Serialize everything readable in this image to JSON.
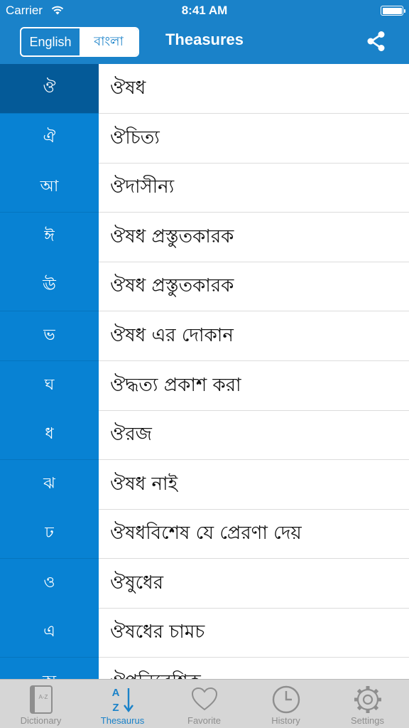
{
  "status_bar": {
    "carrier": "Carrier",
    "time": "8:41 AM"
  },
  "nav": {
    "segments": [
      {
        "label": "English",
        "selected": false
      },
      {
        "label": "বাংলা",
        "selected": true
      }
    ],
    "title": "Theasures"
  },
  "colors": {
    "accent": "#1a82c9",
    "letter_column": "#0882d3",
    "letter_selected": "#045a98"
  },
  "rows": [
    {
      "letter": "ঔ",
      "word": "ঔষধ"
    },
    {
      "letter": "ঐ",
      "word": "ঔচিত্য"
    },
    {
      "letter": "আ",
      "word": "ঔদাসীন্য"
    },
    {
      "letter": "ঈ",
      "word": "ঔষধ প্রস্তুতকারক"
    },
    {
      "letter": "ঊ",
      "word": "ঔষধ প্রস্তুতকারক"
    },
    {
      "letter": "ভ",
      "word": "ঔষধ এর দোকান"
    },
    {
      "letter": "ঘ",
      "word": "ঔদ্ধত্য প্রকাশ করা"
    },
    {
      "letter": "ধ",
      "word": "ঔরজ"
    },
    {
      "letter": "ঝ",
      "word": "ঔষধ নাই"
    },
    {
      "letter": "ঢ",
      "word": "ঔষধবিশেষ যে প্রেরণা দেয়"
    },
    {
      "letter": "ও",
      "word": "ঔষুধের"
    },
    {
      "letter": "এ",
      "word": "ঔষধের চামচ"
    },
    {
      "letter": "অ",
      "word": "ঔপনিবেশিক"
    }
  ],
  "tabs": [
    {
      "label": "Dictionary",
      "icon": "dictionary-book-icon"
    },
    {
      "label": "Thesaurus",
      "icon": "az-sort-icon",
      "active": true
    },
    {
      "label": "Favorite",
      "icon": "heart-icon"
    },
    {
      "label": "History",
      "icon": "clock-icon"
    },
    {
      "label": "Settings",
      "icon": "gear-icon"
    }
  ]
}
